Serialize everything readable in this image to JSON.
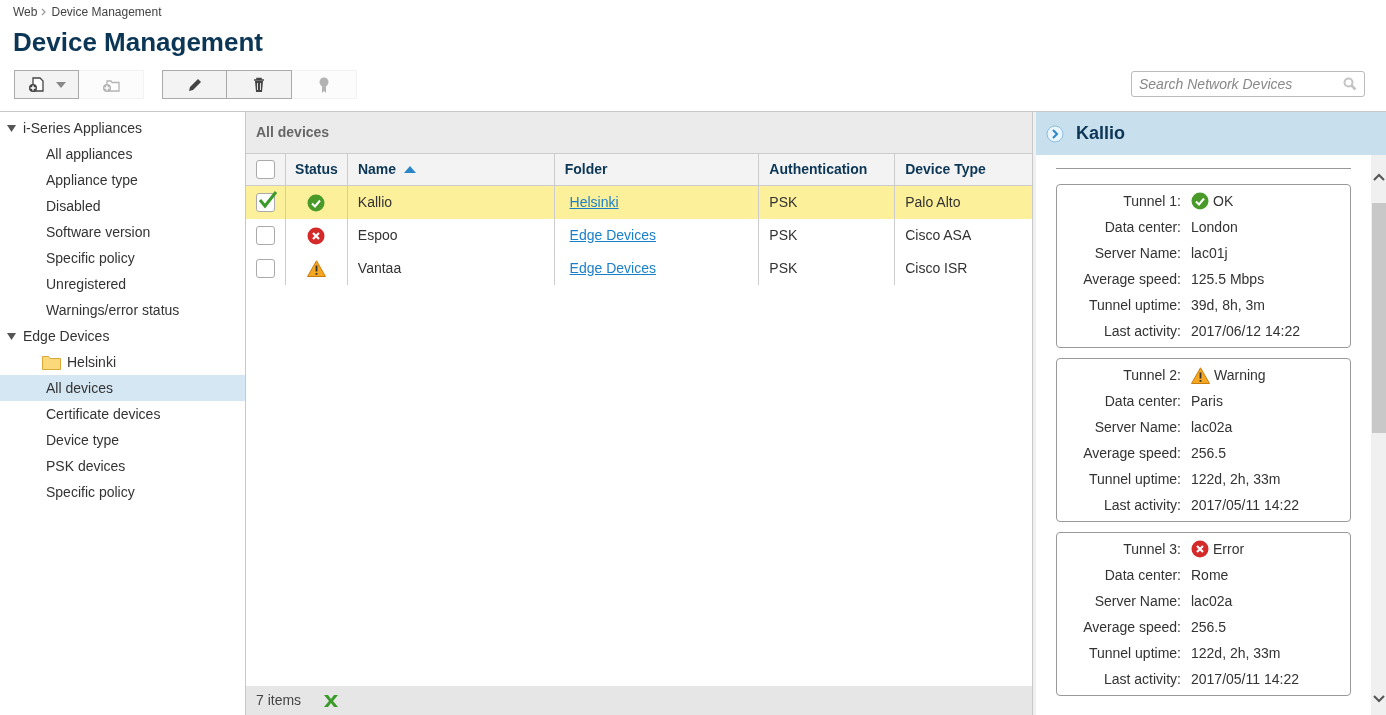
{
  "breadcrumb": [
    "Web",
    "Device Management"
  ],
  "title": "Device Management",
  "toolbar": [
    [
      {
        "kind": "add-document",
        "dropdown": true,
        "disabled": false
      },
      {
        "kind": "add-folder",
        "dropdown": false,
        "disabled": true
      }
    ],
    [
      {
        "kind": "edit",
        "dropdown": false,
        "disabled": false
      },
      {
        "kind": "delete",
        "dropdown": false,
        "disabled": false
      },
      {
        "kind": "certificate",
        "dropdown": false,
        "disabled": true
      }
    ]
  ],
  "search": {
    "placeholder": "Search Network Devices"
  },
  "sidebar": {
    "items": [
      {
        "label": "i-Series Appliances",
        "expanded": true,
        "selected": false,
        "children": [
          {
            "label": "All appliances",
            "selected": false
          },
          {
            "label": "Appliance type",
            "selected": false
          },
          {
            "label": "Disabled",
            "selected": false
          },
          {
            "label": "Software version",
            "selected": false
          },
          {
            "label": "Specific policy",
            "selected": false
          },
          {
            "label": "Unregistered",
            "selected": false
          },
          {
            "label": "Warnings/error status",
            "selected": false
          }
        ]
      },
      {
        "label": "Edge Devices",
        "expanded": true,
        "selected": false,
        "children": [
          {
            "label": "Helsinki",
            "kind": "folder",
            "selected": false
          },
          {
            "label": "All devices",
            "selected": true
          },
          {
            "label": "Certificate devices",
            "selected": false
          },
          {
            "label": "Device type",
            "selected": false
          },
          {
            "label": "PSK devices",
            "selected": false
          },
          {
            "label": "Specific policy",
            "selected": false
          }
        ]
      }
    ]
  },
  "table": {
    "title": "All devices",
    "columns": [
      {
        "label": "Status",
        "sorted": false
      },
      {
        "label": "Name",
        "sorted": true
      },
      {
        "label": "Folder",
        "sorted": false
      },
      {
        "label": "Authentication",
        "sorted": false
      },
      {
        "label": "Device Type",
        "sorted": false
      }
    ],
    "header_checked": false,
    "rows": [
      {
        "checked": true,
        "selected": true,
        "kind": "ok",
        "name": "Kallio",
        "folder": "Helsinki",
        "authentication": "PSK",
        "device_type": "Palo Alto"
      },
      {
        "checked": false,
        "selected": false,
        "kind": "error",
        "name": "Espoo",
        "folder": "Edge Devices",
        "authentication": "PSK",
        "device_type": "Cisco ASA"
      },
      {
        "checked": false,
        "selected": false,
        "kind": "warning",
        "name": "Vantaa",
        "folder": "Edge Devices",
        "authentication": "PSK",
        "device_type": "Cisco ISR"
      }
    ],
    "footer": "7 items"
  },
  "details": {
    "title": "Kallio",
    "tunnels": [
      {
        "kind": "ok",
        "fields": [
          {
            "label": "Tunnel 1:",
            "value": "OK"
          },
          {
            "label": "Data center:",
            "value": "London"
          },
          {
            "label": "Server Name:",
            "value": "lac01j"
          },
          {
            "label": "Average speed:",
            "value": "125.5 Mbps"
          },
          {
            "label": "Tunnel uptime:",
            "value": "39d, 8h, 3m"
          },
          {
            "label": "Last activity:",
            "value": "2017/06/12 14:22"
          }
        ]
      },
      {
        "kind": "warning",
        "fields": [
          {
            "label": "Tunnel 2:",
            "value": "Warning"
          },
          {
            "label": "Data center:",
            "value": "Paris"
          },
          {
            "label": "Server Name:",
            "value": "lac02a"
          },
          {
            "label": "Average speed:",
            "value": "256.5"
          },
          {
            "label": "Tunnel uptime:",
            "value": "122d, 2h, 33m"
          },
          {
            "label": "Last activity:",
            "value": "2017/05/11 14:22"
          }
        ]
      },
      {
        "kind": "error",
        "fields": [
          {
            "label": "Tunnel 3:",
            "value": "Error"
          },
          {
            "label": "Data center:",
            "value": "Rome"
          },
          {
            "label": "Server Name:",
            "value": "lac02a"
          },
          {
            "label": "Average speed:",
            "value": "256.5"
          },
          {
            "label": "Tunnel uptime:",
            "value": "122d, 2h, 33m"
          },
          {
            "label": "Last activity:",
            "value": "2017/05/11 14:22"
          }
        ]
      }
    ]
  }
}
